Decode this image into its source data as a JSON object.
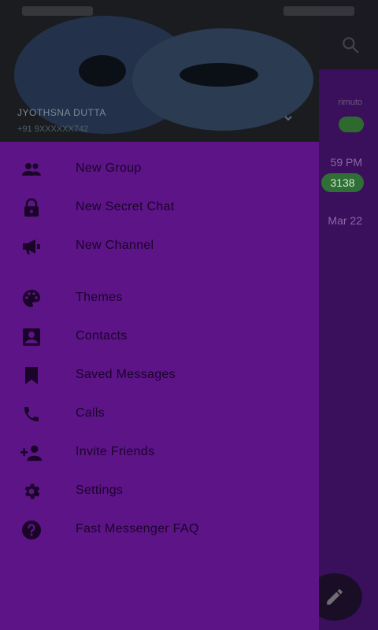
{
  "background_app": {
    "chips": [
      "",
      "3138"
    ],
    "times": [
      "59 PM",
      "Mar 22"
    ],
    "faint_text": "rimuto"
  },
  "drawer": {
    "header": {
      "name": "JYOTHSNA DUTTA",
      "phone": "+91 9XXXXXX742"
    },
    "menu_group_1": [
      {
        "label": "New Group",
        "icon": "group-icon"
      },
      {
        "label": "New Secret Chat",
        "icon": "lock-icon"
      },
      {
        "label": "New Channel",
        "icon": "megaphone-icon"
      }
    ],
    "menu_group_2": [
      {
        "label": "Themes",
        "icon": "palette-icon"
      },
      {
        "label": "Contacts",
        "icon": "contact-card-icon"
      },
      {
        "label": "Saved Messages",
        "icon": "bookmark-icon"
      },
      {
        "label": "Calls",
        "icon": "phone-icon"
      },
      {
        "label": "Invite Friends",
        "icon": "add-person-icon"
      },
      {
        "label": "Settings",
        "icon": "gear-icon"
      },
      {
        "label": "Fast Messenger FAQ",
        "icon": "help-icon"
      }
    ]
  },
  "colors": {
    "drawer_bg": "#5c1487",
    "header_bg": "#1a1c20",
    "text": "#1a0428"
  }
}
